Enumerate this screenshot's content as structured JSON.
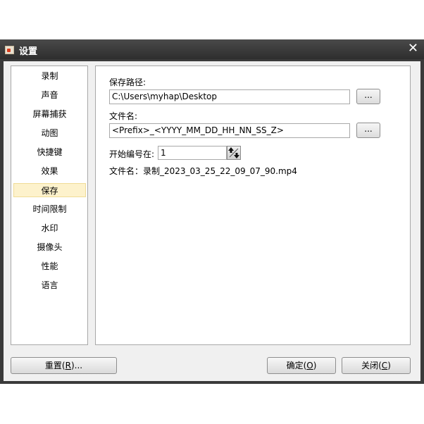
{
  "window": {
    "title": "设置",
    "close_glyph": "✕",
    "icon": "app-icon"
  },
  "sidebar": {
    "items": [
      {
        "label": "录制"
      },
      {
        "label": "声音"
      },
      {
        "label": "屏幕捕获"
      },
      {
        "label": "动图"
      },
      {
        "label": "快捷键"
      },
      {
        "label": "效果"
      },
      {
        "label": "保存",
        "selected": true
      },
      {
        "label": "时间限制"
      },
      {
        "label": "水印"
      },
      {
        "label": "摄像头"
      },
      {
        "label": "性能"
      },
      {
        "label": "语言"
      }
    ]
  },
  "save": {
    "path_label": "保存路径:",
    "path_value": "C:\\Users\\myhap\\Desktop",
    "browse_label": "...",
    "filename_label": "文件名:",
    "filename_value": "<Prefix>_<YYYY_MM_DD_HH_NN_SS_Z>",
    "start_number_label": "开始编号在:",
    "start_number_value": "1",
    "preview_text": "文件名：录制_2023_03_25_22_09_07_90.mp4"
  },
  "buttons": {
    "reset": {
      "label": "重置(",
      "mnemonic": "R",
      "suffix": ")..."
    },
    "ok": {
      "label": "确定(",
      "mnemonic": "O",
      "suffix": ")"
    },
    "close": {
      "label": "关闭(",
      "mnemonic": "C",
      "suffix": ")"
    }
  }
}
